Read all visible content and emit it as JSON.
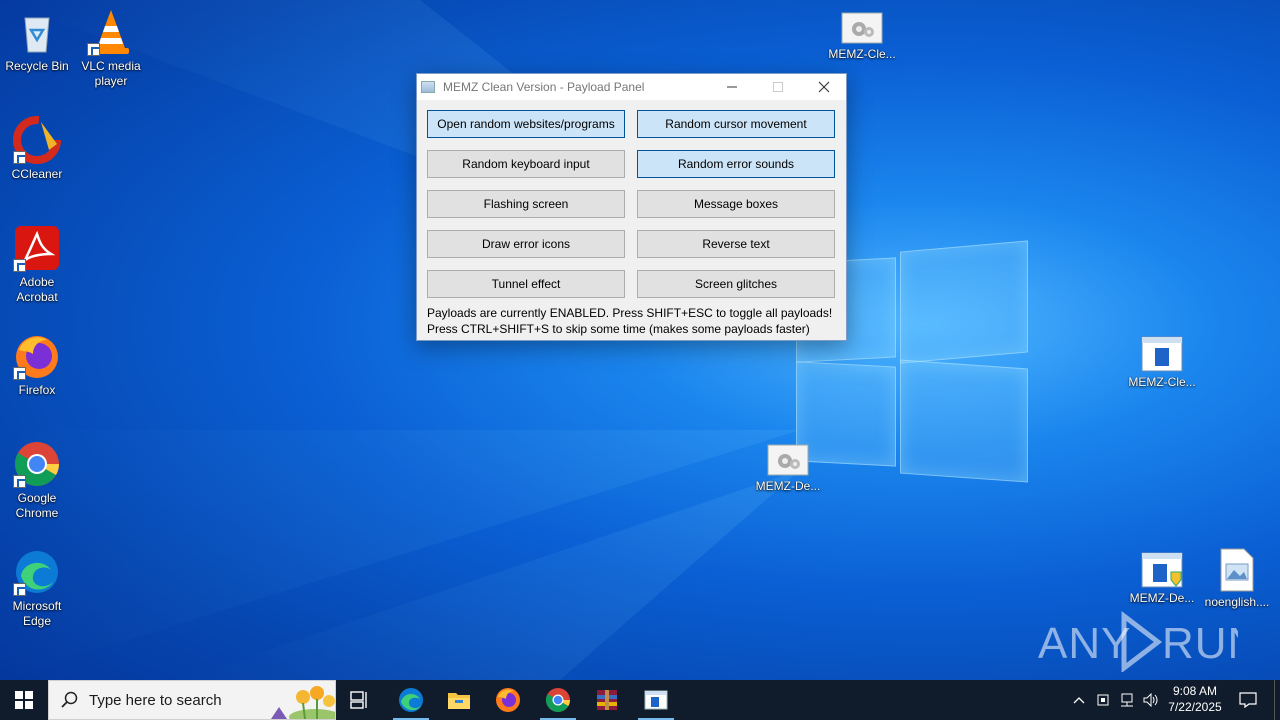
{
  "desktop": {
    "icons": [
      {
        "label": "Recycle Bin",
        "icon": "recycle-bin-icon"
      },
      {
        "label": "VLC media player",
        "icon": "vlc-icon"
      },
      {
        "label": "CCleaner",
        "icon": "ccleaner-icon"
      },
      {
        "label": "Adobe Acrobat",
        "icon": "acrobat-icon"
      },
      {
        "label": "Firefox",
        "icon": "firefox-icon"
      },
      {
        "label": "Google Chrome",
        "icon": "chrome-icon"
      },
      {
        "label": "Microsoft Edge",
        "icon": "edge-icon"
      },
      {
        "label": "MEMZ-Cle...",
        "icon": "gear-window-icon"
      },
      {
        "label": "MEMZ-Cle...",
        "icon": "app-window-icon"
      },
      {
        "label": "MEMZ-De...",
        "icon": "gear-window-icon"
      },
      {
        "label": "MEMZ-De...",
        "icon": "app-window-shield-icon"
      },
      {
        "label": "noenglish....",
        "icon": "image-file-icon"
      }
    ],
    "watermark": "ANY RUN"
  },
  "dialog": {
    "title": "MEMZ Clean Version - Payload Panel",
    "buttons": [
      {
        "label": "Open random websites/programs",
        "active": true
      },
      {
        "label": "Random cursor movement",
        "active": true
      },
      {
        "label": "Random keyboard input",
        "active": false
      },
      {
        "label": "Random error sounds",
        "active": true
      },
      {
        "label": "Flashing screen",
        "active": false
      },
      {
        "label": "Message boxes",
        "active": false
      },
      {
        "label": "Draw error icons",
        "active": false
      },
      {
        "label": "Reverse text",
        "active": false
      },
      {
        "label": "Tunnel effect",
        "active": false
      },
      {
        "label": "Screen glitches",
        "active": false
      }
    ],
    "status_line1": "Payloads are currently ENABLED. Press SHIFT+ESC to toggle all payloads!",
    "status_line2": "Press CTRL+SHIFT+S to skip some time (makes some payloads faster)"
  },
  "taskbar": {
    "search_placeholder": "Type here to search",
    "apps": [
      "task-view-icon",
      "edge-icon",
      "file-explorer-icon",
      "firefox-icon",
      "chrome-icon",
      "winrar-icon",
      "memz-window-icon"
    ],
    "time": "9:08 AM",
    "date": "7/22/2025"
  },
  "colors": {
    "active_button": "#cce4f7",
    "taskbar": "#101b2b",
    "desktop_accent": "#1b86ee"
  }
}
